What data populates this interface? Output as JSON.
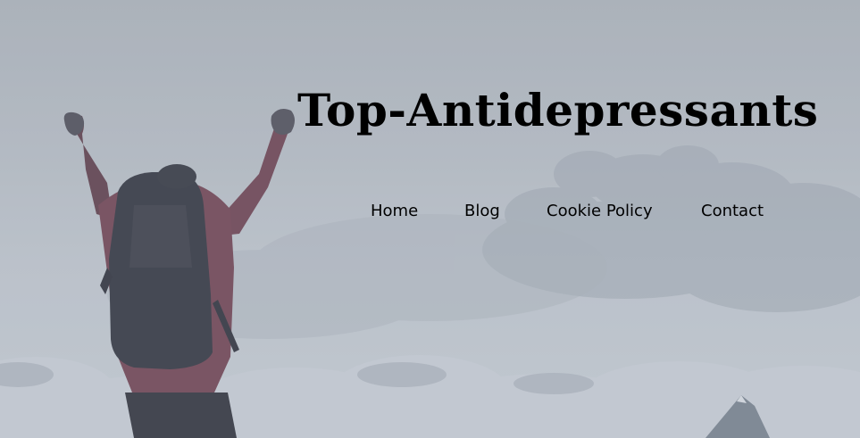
{
  "site": {
    "title": "Top-Antidepressants"
  },
  "nav": {
    "items": [
      {
        "label": "Home"
      },
      {
        "label": "Blog"
      },
      {
        "label": "Cookie Policy"
      },
      {
        "label": "Contact"
      }
    ]
  },
  "colors": {
    "overlay": "#b6bdc5",
    "text": "#000000",
    "jacket": "#6e3f4e",
    "backpack": "#2c2f3a"
  },
  "hero_image": {
    "icon": "climber-summit-image"
  }
}
